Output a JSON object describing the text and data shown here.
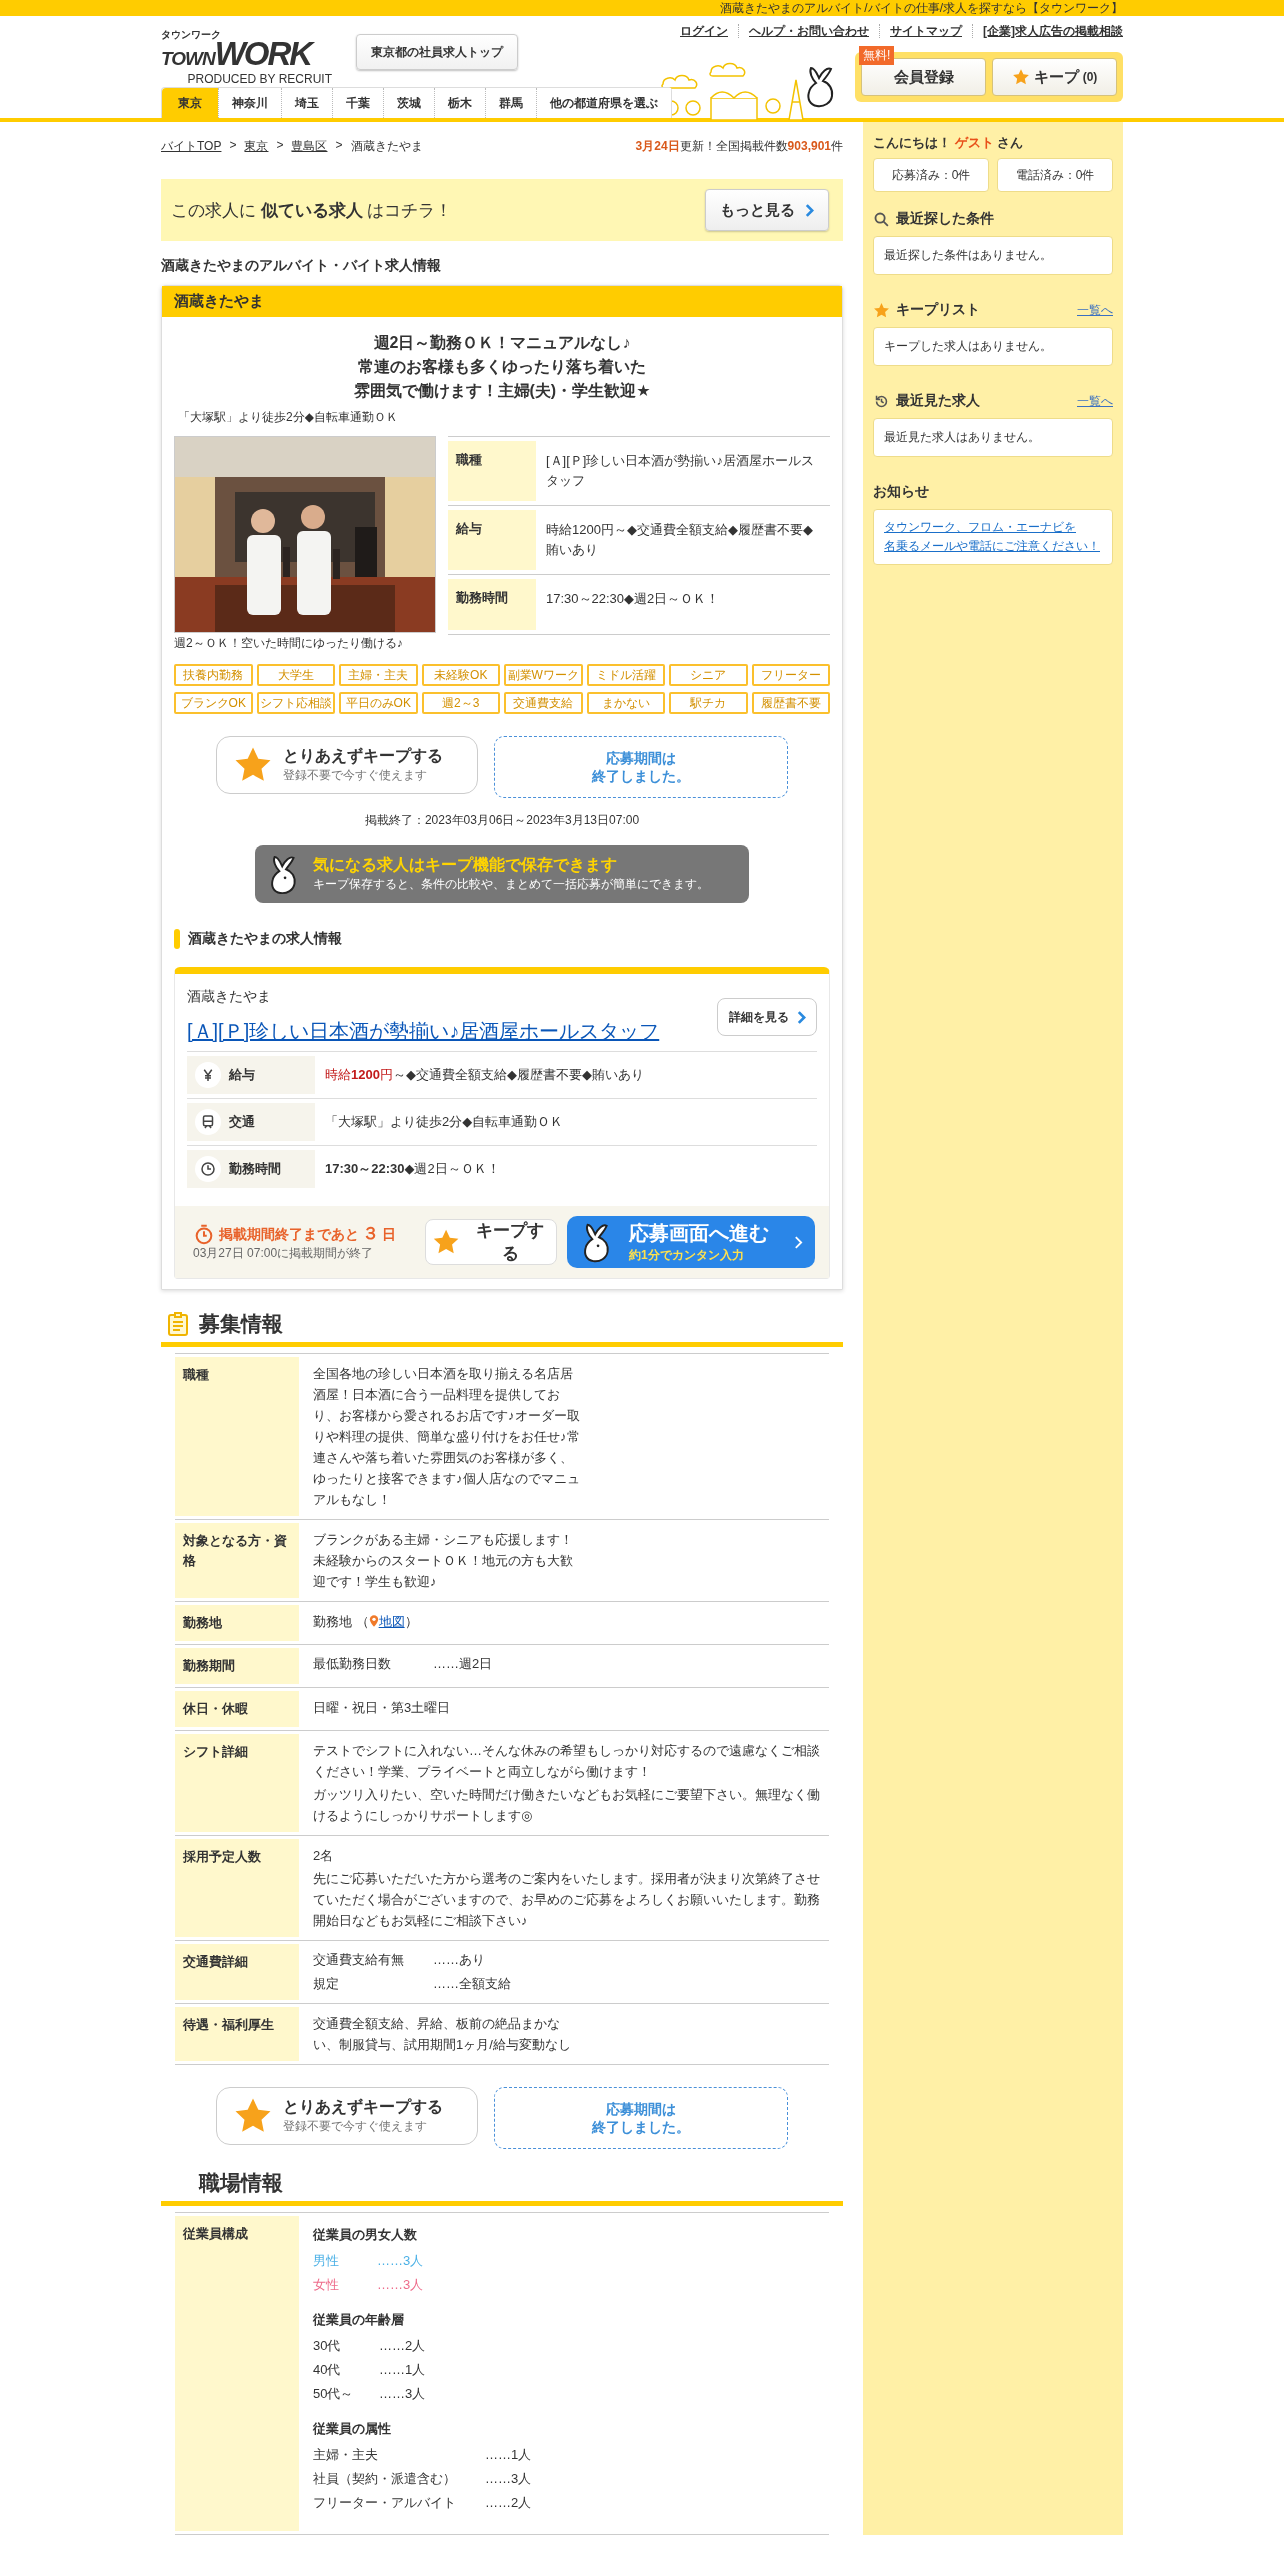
{
  "top_strip": {
    "text": "酒蔵きたやまのアルバイト/バイトの仕事/求人を探すなら【タウンワーク】"
  },
  "header": {
    "logo": {
      "kana": "タウンワーク",
      "word_1": "TOWN",
      "word_2": "WORK",
      "credit": "PRODUCED BY RECRUIT"
    },
    "employee_top_button": "東京都の社員求人トップ",
    "links": [
      "ログイン",
      "ヘルプ・お問い合わせ",
      "サイトマップ",
      "[企業]求人広告の掲載相談"
    ],
    "register": {
      "badge": "無料!",
      "label": "会員登録"
    },
    "keep": {
      "label": "キープ",
      "count": "(0)"
    }
  },
  "prefecture_tabs": [
    {
      "label": "東京",
      "selected": true
    },
    {
      "label": "神奈川",
      "selected": false
    },
    {
      "label": "埼玉",
      "selected": false
    },
    {
      "label": "千葉",
      "selected": false
    },
    {
      "label": "茨城",
      "selected": false
    },
    {
      "label": "栃木",
      "selected": false
    },
    {
      "label": "群馬",
      "selected": false
    },
    {
      "label": "他の都道府県を選ぶ",
      "selected": false
    }
  ],
  "breadcrumb": {
    "separator": ">",
    "items": [
      {
        "label": "バイトTOP",
        "link": true
      },
      {
        "label": "東京",
        "link": true
      },
      {
        "label": "豊島区",
        "link": true
      },
      {
        "label": "酒蔵きたやま",
        "link": false
      }
    ]
  },
  "update": {
    "date": "3月24日",
    "text_1": "更新！全国掲載件数",
    "count": "903,901",
    "text_2": "件"
  },
  "similar_banner": {
    "text": "この求人に **似ている求人** はコチラ！",
    "button": "もっと見る"
  },
  "page_heading": "酒蔵きたやまのアルバイト・バイト求人情報",
  "listing": {
    "title": "酒蔵きたやま",
    "catch_lines": [
      "週2日～勤務ＯＫ！マニュアルなし♪",
      "常連のお客様も多くゆったり落ち着いた",
      "雰囲気で働けます！主婦(夫)・学生歓迎★"
    ],
    "access": "「大塚駅」より徒歩2分◆自転車通勤ＯＫ",
    "photo": {
      "kind": "picture",
      "caption": "週2～ＯＫ！空いた時間にゆったり働ける♪"
    },
    "summary": [
      {
        "label": "職種",
        "value": "[Ａ][Ｐ]珍しい日本酒が勢揃い♪居酒屋ホールスタッフ"
      },
      {
        "label": "給与",
        "value": "時給1200円～◆交通費全額支給◆履歴書不要◆賄いあり"
      },
      {
        "label": "勤務時間",
        "value": "17:30～22:30◆週2日～ＯＫ！"
      }
    ],
    "tags": [
      "扶養内勤務",
      "大学生",
      "主婦・主夫",
      "未経験OK",
      "副業Wワーク",
      "ミドル活躍",
      "シニア",
      "フリーター",
      "ブランクOK",
      "シフト応相談",
      "平日のみOK",
      "週2～3",
      "交通費支給",
      "まかない",
      "駅チカ",
      "履歴書不要"
    ],
    "keep_button": {
      "title": "とりあえずキープする",
      "subtitle": "登録不要で今すぐ使えます"
    },
    "closed_notice": [
      "応募期間は",
      "終了しました。"
    ],
    "period": "掲載終了：2023年03月06日～2023年3月13日07:00"
  },
  "keep_banner": {
    "title": "気になる求人はキープ機能で保存できます",
    "text": "キープ保存すると、条件の比較や、まとめて一括応募が簡単にできます。"
  },
  "job_info": {
    "heading": "酒蔵きたやまの求人情報",
    "shop": "酒蔵きたやま",
    "title": "[Ａ][Ｐ]珍しい日本酒が勢揃い♪居酒屋ホールスタッフ",
    "detail_button": "詳細を見る",
    "rows": [
      {
        "kind": "salary",
        "label": "給与",
        "highlight": "時給**1200**円",
        "value": "～◆交通費全額支給◆履歴書不要◆賄いあり"
      },
      {
        "kind": "train",
        "label": "交通",
        "value": "「大塚駅」より徒歩2分◆自転車通勤ＯＫ"
      },
      {
        "kind": "clock",
        "label": "勤務時間",
        "value": "**17:30～22:30**◆週2日～ＯＫ！"
      }
    ],
    "deadline": "掲載期間終了まであと**３**日",
    "deadline_note": "03月27日 07:00に掲載期間が終了",
    "keep_button": "キープする",
    "apply_button": {
      "title": "応募画面へ進む",
      "subtitle": "約1分でカンタン入力"
    }
  },
  "recruitment": {
    "heading": "募集情報",
    "rows": [
      {
        "kind": "text",
        "label": "職種",
        "paragraphs": [
          "全国各地の珍しい日本酒を取り揃える名店居酒屋！日本酒に合う一品料理を提供しており、お客様から愛されるお店です♪オーダー取りや料理の提供、簡単な盛り付けをお任せ♪常連さんや落ち着いた雰囲気のお客様が多く、ゆったりと接客できます♪個人店なのでマニュアルもなし！"
        ],
        "narrow": true
      },
      {
        "kind": "text",
        "label": "対象となる方・資格",
        "paragraphs": [
          "ブランクがある主婦・シニアも応援します！未経験からのスタートＯＫ！地元の方も大歓迎です！学生も歓迎♪"
        ],
        "narrow": true
      },
      {
        "kind": "map",
        "label": "勤務地",
        "text": "勤務地 （",
        "link": "地図",
        "close": "）"
      },
      {
        "kind": "pairs",
        "label": "勤務期間",
        "pairs": [
          {
            "name": "最低勤務日数",
            "value": "……週2日"
          }
        ]
      },
      {
        "kind": "text",
        "label": "休日・休暇",
        "paragraphs": [
          "日曜・祝日・第3土曜日"
        ]
      },
      {
        "kind": "text",
        "label": "シフト詳細",
        "paragraphs": [
          "テストでシフトに入れない…そんな休みの希望もしっかり対応するので遠慮なくご相談ください！学業、プライベートと両立しながら働けます！",
          "ガッツリ入りたい、空いた時間だけ働きたいなどもお気軽にご要望下さい。無理なく働けるようにしっかりサポートします◎"
        ]
      },
      {
        "kind": "text",
        "label": "採用予定人数",
        "paragraphs": [
          "2名",
          "先にご応募いただいた方から選考のご案内をいたします。採用者が決まり次第終了させていただく場合がございますので、お早めのご応募をよろしくお願いいたします。勤務開始日などもお気軽にご相談下さい♪"
        ]
      },
      {
        "kind": "pairs",
        "label": "交通費詳細",
        "pairs": [
          {
            "name": "交通費支給有無",
            "value": "……あり"
          },
          {
            "name": "規定",
            "value": "……全額支給"
          }
        ]
      },
      {
        "kind": "text",
        "label": "待遇・福利厚生",
        "paragraphs": [
          "交通費全額支給、昇給、板前の絶品まかない、制服貸与、試用期間1ヶ月/給与変動なし"
        ],
        "narrow": true
      }
    ]
  },
  "bottom_buttons": {
    "keep_button": {
      "title": "とりあえずキープする",
      "subtitle": "登録不要で今すぐ使えます"
    },
    "closed_notice": [
      "応募期間は",
      "終了しました。"
    ]
  },
  "workplace": {
    "heading": "職場情報",
    "rows": [
      {
        "label": "従業員構成",
        "groups": [
          {
            "title": "従業員の男女人数",
            "items": [
              {
                "name": "男性",
                "value": "……3人",
                "color": "#4ab0e6"
              },
              {
                "name": "女性",
                "value": "……3人",
                "color": "#ee6b8a"
              }
            ]
          },
          {
            "title": "従業員の年齢層",
            "items": [
              {
                "name": "30代",
                "value": "……2人"
              },
              {
                "name": "40代",
                "value": "……1人"
              },
              {
                "name": "50代～",
                "value": "……3人"
              }
            ]
          },
          {
            "title": "従業員の属性",
            "wide": true,
            "items": [
              {
                "name": "主婦・主夫",
                "value": "……1人"
              },
              {
                "name": "社員（契約・派遣含む）",
                "value": "……3人"
              },
              {
                "name": "フリーター・アルバイト",
                "value": "……2人"
              }
            ]
          }
        ]
      }
    ]
  },
  "sidebar": {
    "greeting": "こんにちは！",
    "user": "ゲスト",
    "suffix": "さん",
    "counters": [
      "応募済み：0件",
      "電話済み：0件"
    ],
    "panels": [
      {
        "kind": "search",
        "title": "最近探した条件",
        "message": "最近探した条件はありません。"
      },
      {
        "kind": "star",
        "title": "キープリスト",
        "link": "一覧へ",
        "message": "キープした求人はありません。"
      },
      {
        "kind": "history",
        "title": "最近見た求人",
        "link": "一覧へ",
        "message": "最近見た求人はありません。"
      }
    ],
    "notice": {
      "title": "お知らせ",
      "link_lines": [
        "タウンワーク、フロム・エーナビを",
        "名乗るメールや電話にご注意ください！"
      ]
    }
  }
}
